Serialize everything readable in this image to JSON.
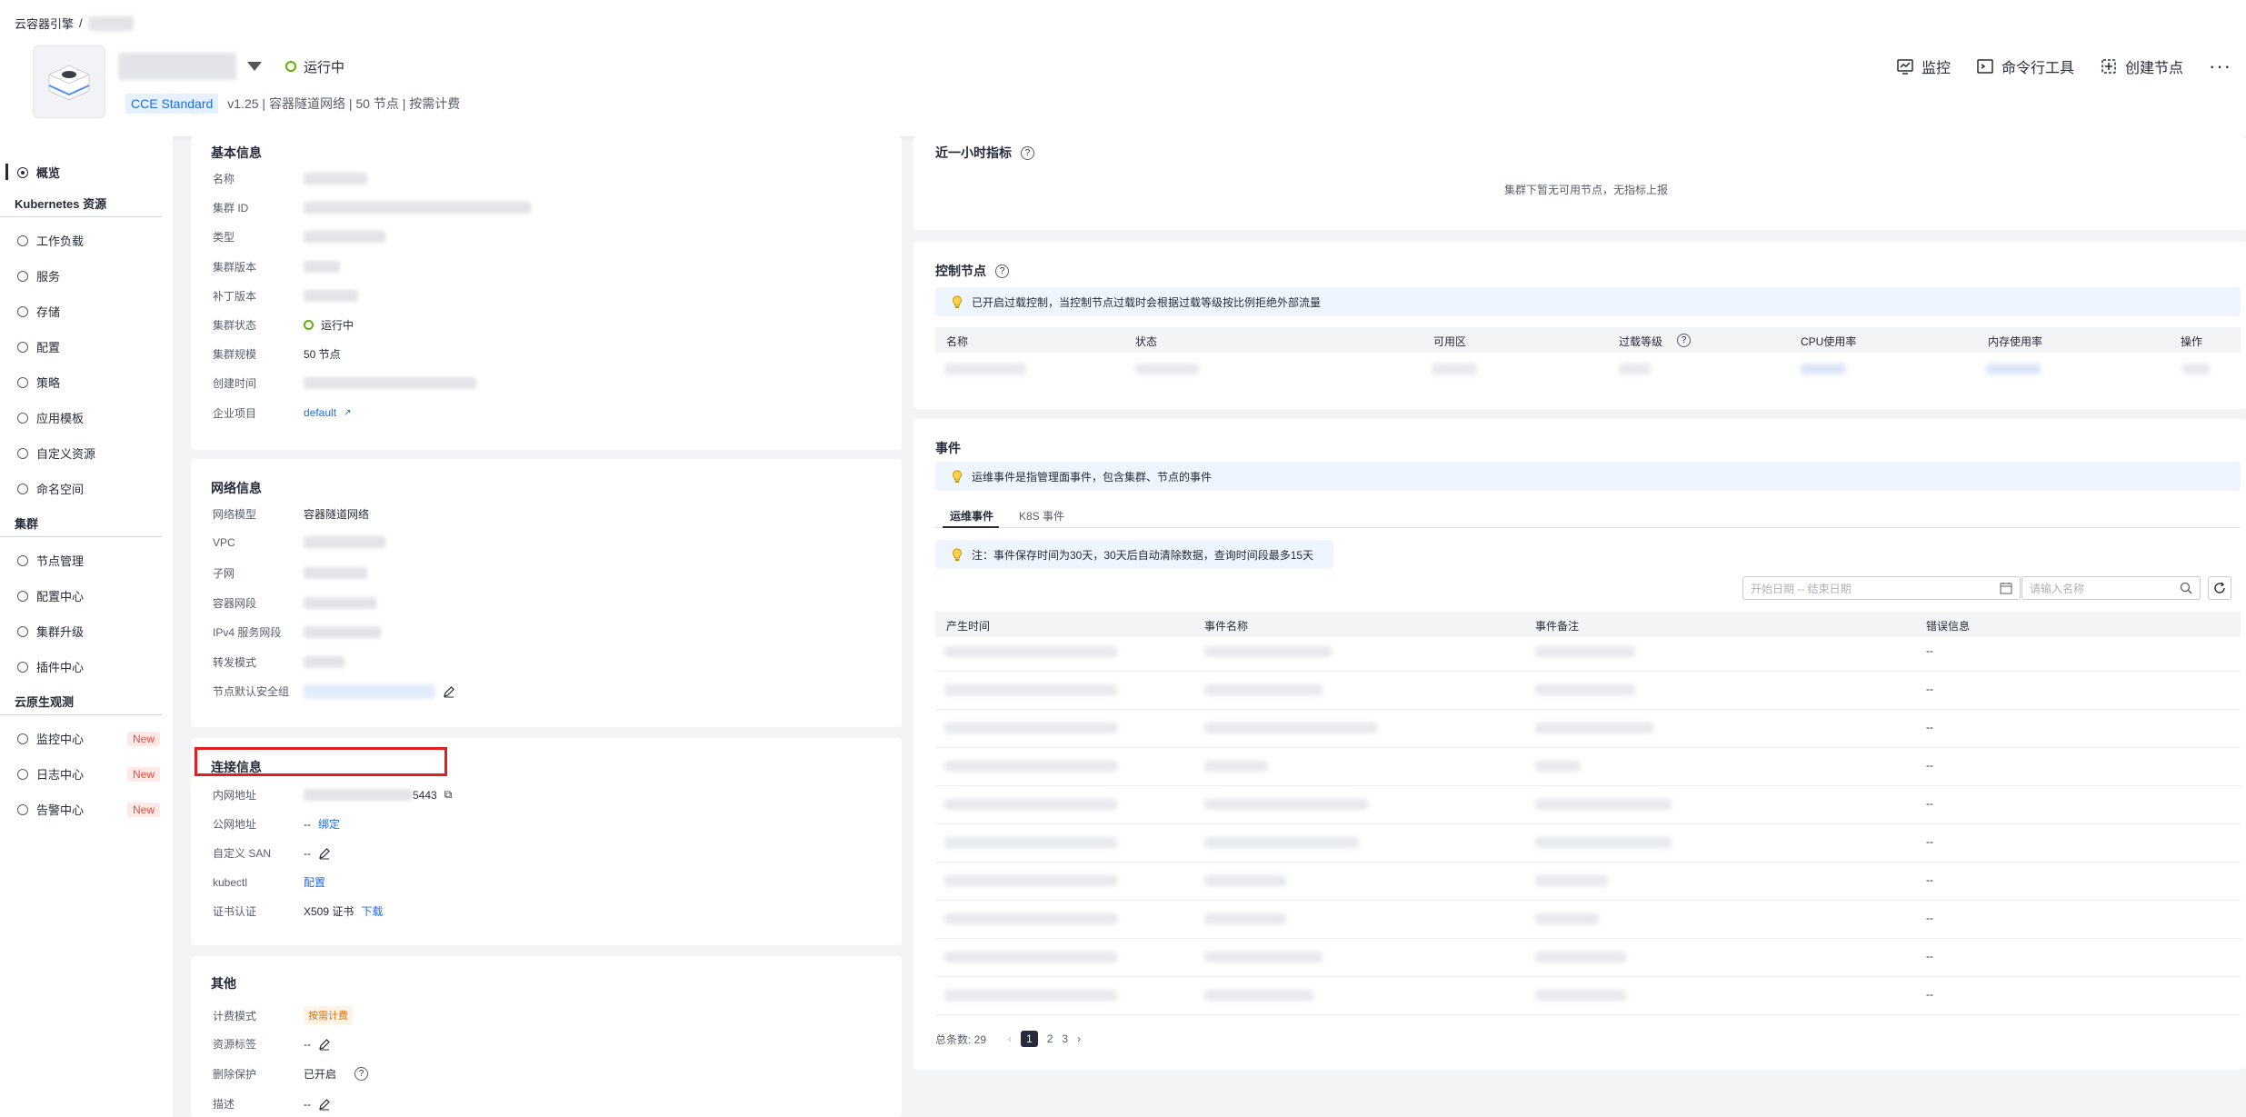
{
  "breadcrumb": {
    "root": "云容器引擎",
    "sep": "/"
  },
  "cluster": {
    "status": "运行中",
    "edition_tag": "CCE Standard",
    "meta": "v1.25 | 容器隧道网络 | 50 节点 | 按需计费"
  },
  "header_actions": {
    "monitor": "监控",
    "cli": "命令行工具",
    "create_node": "创建节点",
    "more": "···"
  },
  "sidebar": {
    "overview": "概览",
    "k8s_section": "Kubernetes 资源",
    "k8s_items": [
      "工作负载",
      "服务",
      "存储",
      "配置",
      "策略",
      "应用模板",
      "自定义资源",
      "命名空间"
    ],
    "cluster_section": "集群",
    "cluster_items": [
      "节点管理",
      "配置中心",
      "集群升级",
      "插件中心"
    ],
    "cloud_section": "云原生观测",
    "cloud_items": [
      "监控中心",
      "日志中心",
      "告警中心"
    ],
    "new_badge": "New"
  },
  "basic": {
    "title": "基本信息",
    "labels": [
      "名称",
      "集群 ID",
      "类型",
      "集群版本",
      "补丁版本",
      "集群状态",
      "集群规模",
      "创建时间",
      "企业项目"
    ],
    "status": "运行中",
    "scale": "50 节点",
    "enterprise_project": "default"
  },
  "network": {
    "title": "网络信息",
    "labels": [
      "网络模型",
      "VPC",
      "子网",
      "容器网段",
      "IPv4 服务网段",
      "转发模式",
      "节点默认安全组"
    ],
    "model": "容器隧道网络"
  },
  "connection": {
    "title": "连接信息",
    "labels": [
      "内网地址",
      "公网地址",
      "自定义 SAN",
      "kubectl",
      "证书认证"
    ],
    "port": "5443",
    "public_value": "--",
    "bind": "绑定",
    "san_value": "--",
    "kubectl_link": "配置",
    "cert": "X509 证书",
    "download": "下载"
  },
  "other": {
    "title": "其他",
    "labels": [
      "计费模式",
      "资源标签",
      "删除保护",
      "描述"
    ],
    "billing": "按需计费",
    "tags_value": "--",
    "protection": "已开启",
    "desc_value": "--"
  },
  "metrics": {
    "title": "近一小时指标",
    "empty": "集群下暂无可用节点，无指标上报"
  },
  "control": {
    "title": "控制节点",
    "tip": "已开启过载控制，当控制节点过载时会根据过载等级按比例拒绝外部流量",
    "columns": [
      "名称",
      "状态",
      "可用区",
      "过载等级",
      "CPU使用率",
      "内存使用率",
      "操作"
    ]
  },
  "events": {
    "title": "事件",
    "tip": "运维事件是指管理面事件，包含集群、节点的事件",
    "tabs": [
      "运维事件",
      "K8S 事件"
    ],
    "note": "注：事件保存时间为30天，30天后自动清除数据，查询时间段最多15天",
    "date_placeholder": "开始日期 -- 结束日期",
    "search_placeholder": "请输入名称",
    "columns": [
      "产生时间",
      "事件名称",
      "事件备注",
      "错误信息"
    ],
    "row_error": "--",
    "total_label": "总条数: 29",
    "pages": [
      "1",
      "2",
      "3"
    ]
  }
}
